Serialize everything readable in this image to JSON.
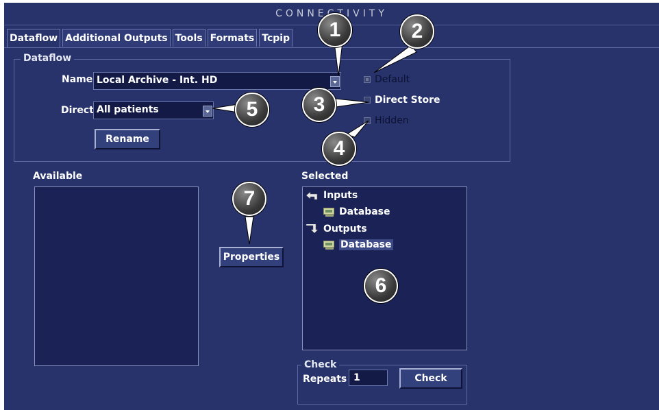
{
  "window": {
    "title": "CONNECTIVITY"
  },
  "tabs": [
    {
      "label": "Dataflow",
      "active": true
    },
    {
      "label": "Additional Outputs",
      "active": false
    },
    {
      "label": "Tools",
      "active": false
    },
    {
      "label": "Formats",
      "active": false
    },
    {
      "label": "Tcpip",
      "active": false
    }
  ],
  "dataflow": {
    "group_label": "Dataflow",
    "name_label": "Name",
    "name_value": "Local Archive - Int. HD",
    "direct_label": "Direct",
    "direct_value": "All patients",
    "rename_button": "Rename",
    "options": [
      {
        "label": "Default",
        "checked": true,
        "enabled": false
      },
      {
        "label": "Direct Store",
        "checked": false,
        "enabled": true
      },
      {
        "label": "Hidden",
        "checked": false,
        "enabled": false
      }
    ]
  },
  "available": {
    "label": "Available"
  },
  "properties_button": "Properties",
  "selected": {
    "label": "Selected",
    "inputs_label": "Inputs",
    "inputs_item": "Database",
    "outputs_label": "Outputs",
    "outputs_item": "Database"
  },
  "check": {
    "group_label": "Check",
    "repeats_label": "Repeats",
    "repeats_value": "1",
    "check_button": "Check"
  },
  "callouts": [
    "1",
    "2",
    "3",
    "4",
    "5",
    "6",
    "7"
  ],
  "colors": {
    "background": "#27336a",
    "field": "#131a45",
    "list": "#1b2356",
    "border": "#6b78b0"
  }
}
